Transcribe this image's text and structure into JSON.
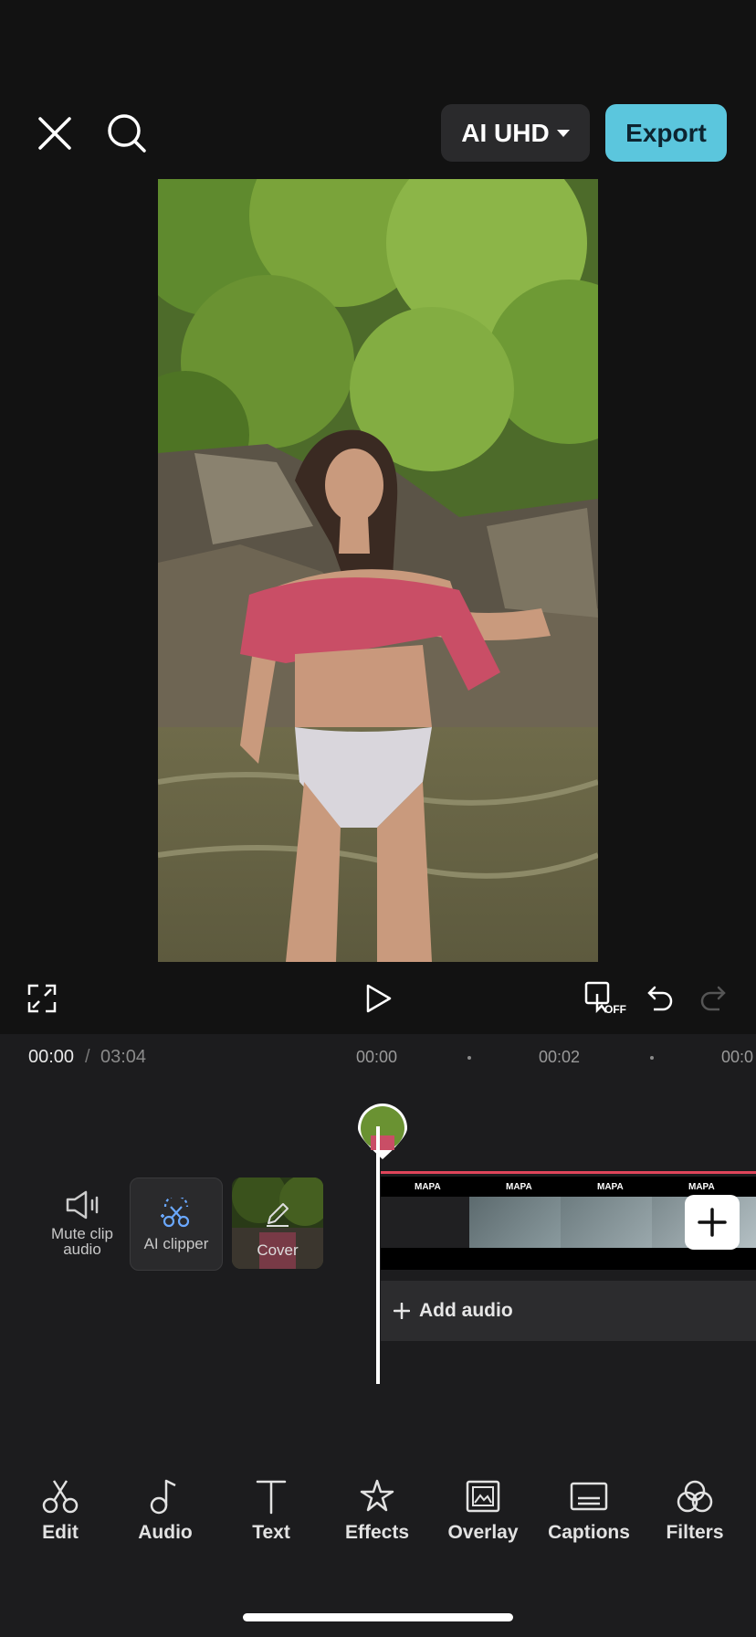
{
  "topbar": {
    "close_icon": "close-icon",
    "search_icon": "search-icon",
    "quality_label": "AI UHD",
    "export_label": "Export"
  },
  "player": {
    "fullscreen_icon": "fullscreen-icon",
    "play_icon": "play-icon",
    "keyframe_off_badge": "OFF",
    "undo_icon": "undo-icon",
    "redo_icon": "redo-icon"
  },
  "timecode": {
    "current": "00:00",
    "separator": "/",
    "total": "03:04",
    "ticks": [
      "00:00",
      "00:02",
      "00:0"
    ]
  },
  "timeline": {
    "mute_label": "Mute clip audio",
    "ai_clipper_label": "AI clipper",
    "cover_label": "Cover",
    "clip_labels": [
      "MAPA",
      "MAPA",
      "MAPA",
      "MAPA"
    ],
    "add_audio_label": "Add audio"
  },
  "nav": [
    {
      "label": "Edit",
      "icon": "scissors-icon"
    },
    {
      "label": "Audio",
      "icon": "music-note-icon"
    },
    {
      "label": "Text",
      "icon": "text-icon"
    },
    {
      "label": "Effects",
      "icon": "sparkle-icon"
    },
    {
      "label": "Overlay",
      "icon": "overlay-icon"
    },
    {
      "label": "Captions",
      "icon": "captions-icon"
    },
    {
      "label": "Filters",
      "icon": "filters-icon"
    }
  ],
  "colors": {
    "background": "#121212",
    "panel": "#1c1c1e",
    "accent_export": "#5bc6dd",
    "timeline_marker": "#e0455a"
  }
}
